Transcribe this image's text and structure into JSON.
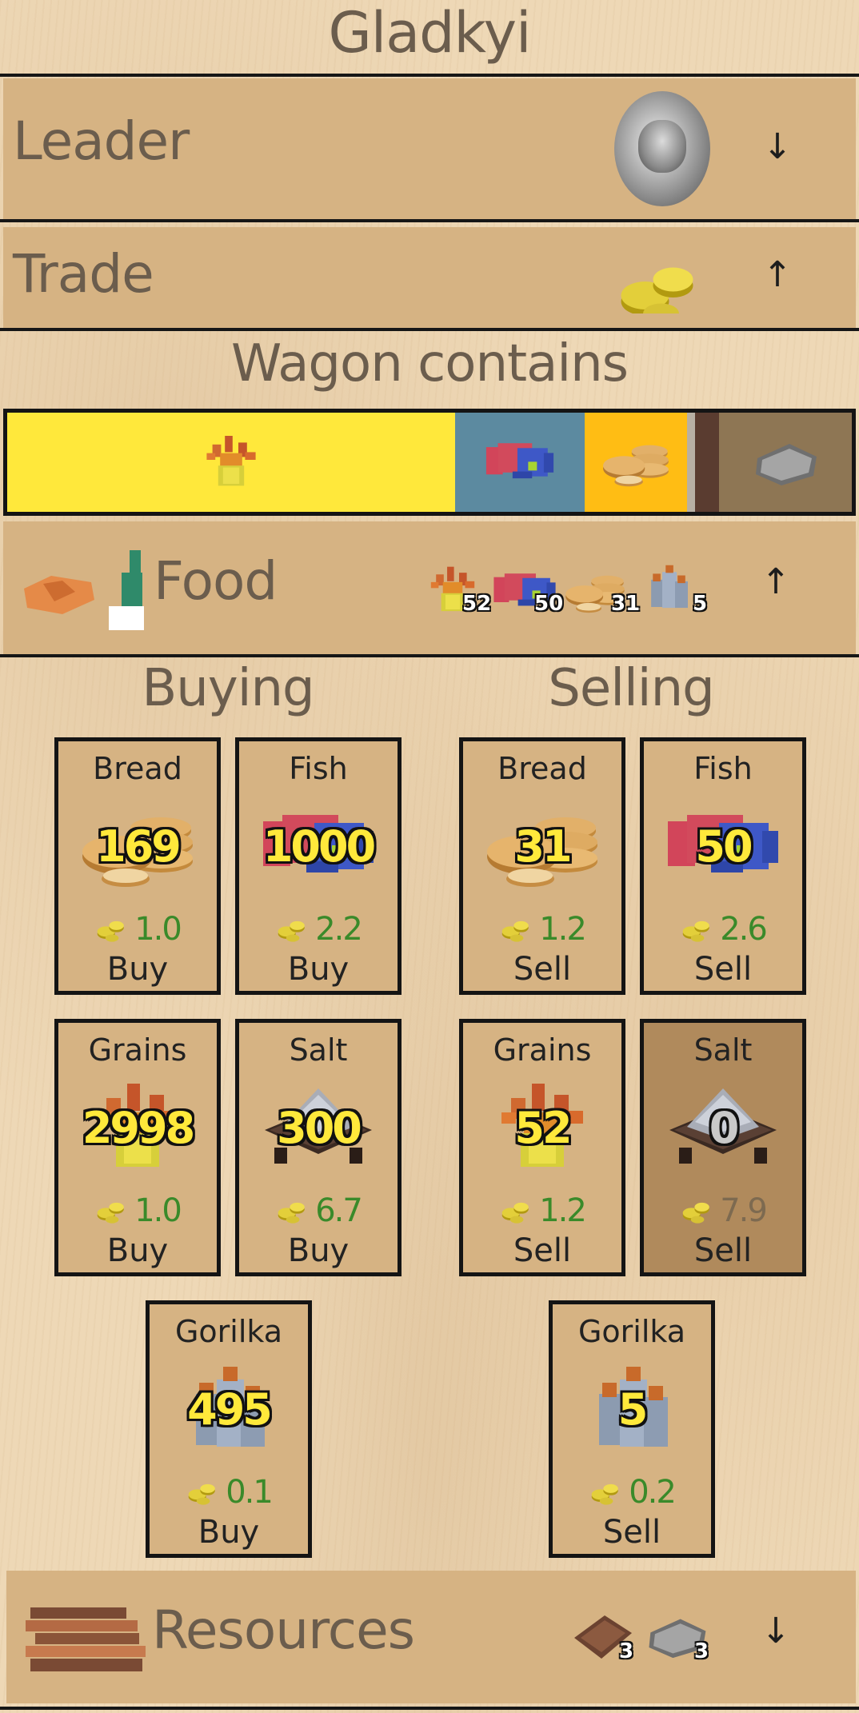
{
  "header": {
    "title": "Gladkyi"
  },
  "leader_row": {
    "label": "Leader",
    "arrow": "↓",
    "icon": "leader-portrait-icon"
  },
  "trade_row": {
    "label": "Trade",
    "arrow": "↑",
    "icon": "coins-icon"
  },
  "wagon": {
    "heading": "Wagon contains",
    "segments": [
      {
        "name": "grains",
        "color": "#ffe83b",
        "fraction": 0.52
      },
      {
        "name": "fish",
        "color": "#5c8aa0",
        "fraction": 0.15
      },
      {
        "name": "bread",
        "color": "#ffbd14",
        "fraction": 0.12
      },
      {
        "name": "gorilka",
        "color": "#b8b0a4",
        "fraction": 0.01
      },
      {
        "name": "planks",
        "color": "#5a3c30",
        "fraction": 0.03
      },
      {
        "name": "stone",
        "color": "#8e7654",
        "fraction": 0.15
      }
    ]
  },
  "food_row": {
    "label": "Food",
    "arrow": "↑",
    "counts": [
      "52",
      "50",
      "31",
      "5"
    ]
  },
  "buying": {
    "heading": "Buying",
    "cards": [
      {
        "name": "Bread",
        "qty": "169",
        "price": "1.0",
        "action": "Buy"
      },
      {
        "name": "Fish",
        "qty": "1000",
        "price": "2.2",
        "action": "Buy"
      },
      {
        "name": "Grains",
        "qty": "2998",
        "price": "1.0",
        "action": "Buy"
      },
      {
        "name": "Salt",
        "qty": "300",
        "price": "6.7",
        "action": "Buy"
      },
      {
        "name": "Gorilka",
        "qty": "495",
        "price": "0.1",
        "action": "Buy"
      }
    ]
  },
  "selling": {
    "heading": "Selling",
    "cards": [
      {
        "name": "Bread",
        "qty": "31",
        "price": "1.2",
        "action": "Sell"
      },
      {
        "name": "Fish",
        "qty": "50",
        "price": "2.6",
        "action": "Sell"
      },
      {
        "name": "Grains",
        "qty": "52",
        "price": "1.2",
        "action": "Sell"
      },
      {
        "name": "Salt",
        "qty": "0",
        "price": "7.9",
        "action": "Sell"
      },
      {
        "name": "Gorilka",
        "qty": "5",
        "price": "0.2",
        "action": "Sell"
      }
    ]
  },
  "resources_row": {
    "label": "Resources",
    "arrow": "↓",
    "counts": [
      "3",
      "3"
    ]
  }
}
